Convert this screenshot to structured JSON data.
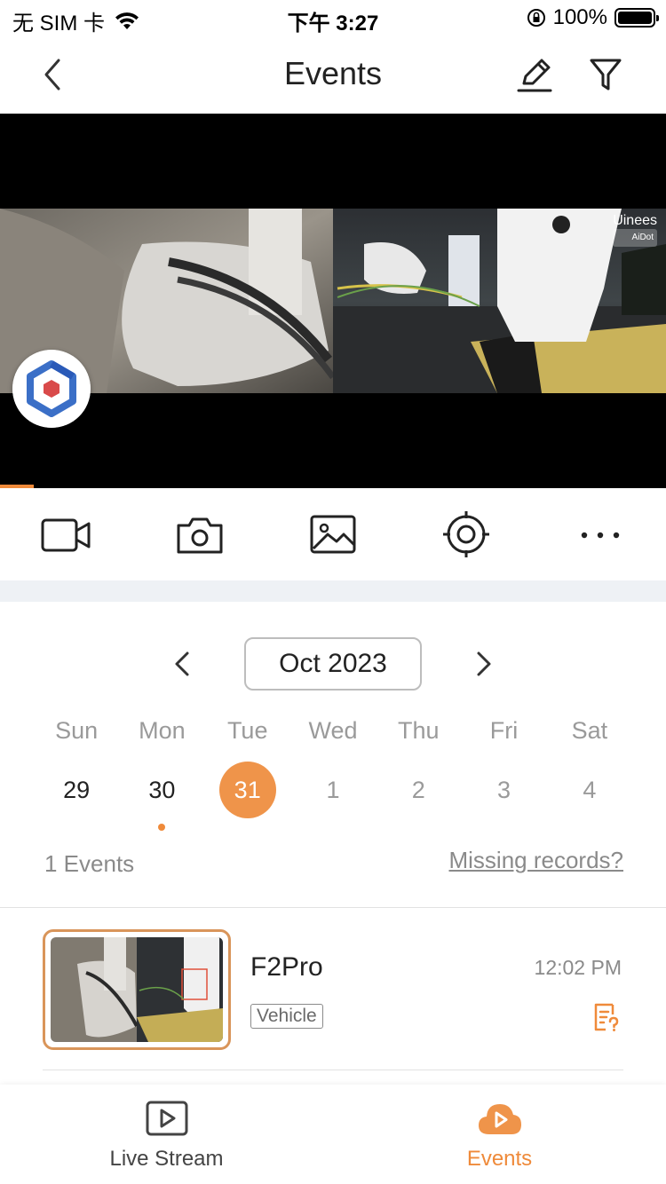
{
  "status_bar": {
    "carrier": "无 SIM 卡",
    "time": "下午 3:27",
    "battery": "100%"
  },
  "nav": {
    "title": "Events",
    "back_icon": "chevron-left-icon",
    "edit_icon": "pencil-icon",
    "filter_icon": "filter-icon"
  },
  "video": {
    "brand": "Uinees",
    "sub_brand": "AiDot",
    "playback_progress": 0.05
  },
  "toolbar": {
    "items": [
      {
        "icon": "video-camera-icon"
      },
      {
        "icon": "camera-icon"
      },
      {
        "icon": "image-icon"
      },
      {
        "icon": "target-icon"
      },
      {
        "icon": "more-icon"
      }
    ]
  },
  "calendar": {
    "month": "Oct 2023",
    "weekdays": [
      "Sun",
      "Mon",
      "Tue",
      "Wed",
      "Thu",
      "Fri",
      "Sat"
    ],
    "days": [
      "29",
      "30",
      "31",
      "1",
      "2",
      "3",
      "4"
    ],
    "selected_day": "31",
    "event_dot_day": "30"
  },
  "summary": {
    "events_count": "1 Events",
    "missing_link": "Missing records?"
  },
  "events": [
    {
      "device": "F2Pro",
      "time": "12:02 PM",
      "tag": "Vehicle"
    }
  ],
  "tabs": [
    {
      "label": "Live Stream",
      "icon": "play-square-icon",
      "active": false
    },
    {
      "label": "Events",
      "icon": "cloud-play-icon",
      "active": true
    }
  ],
  "colors": {
    "accent": "#EF8A3A",
    "muted_text": "#9A9A9A",
    "separator": "#EEF1F5"
  }
}
